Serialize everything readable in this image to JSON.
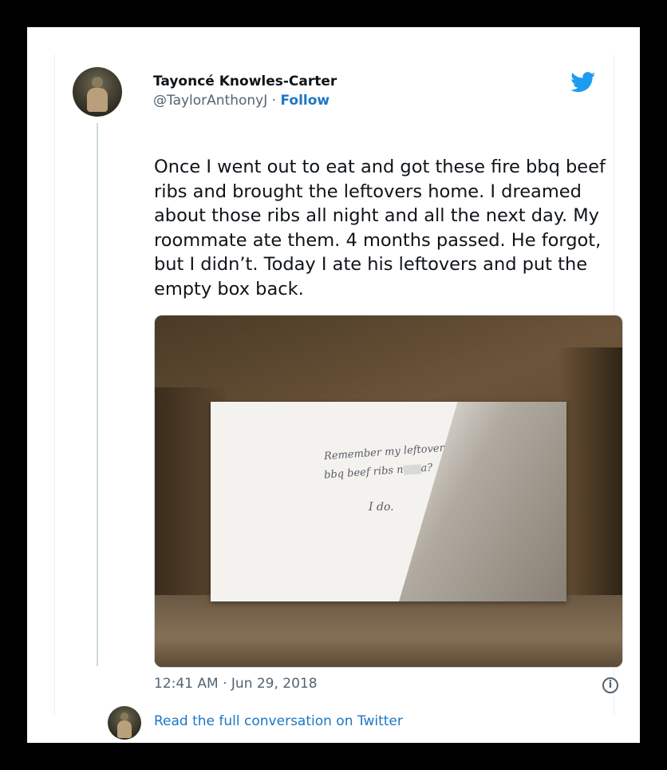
{
  "tweet": {
    "author_name": "Tayoncé Knowles-Carter",
    "author_handle": "@TaylorAnthonyJ",
    "separator": "·",
    "follow_label": "Follow",
    "text": "Once I went out to eat and got these fire bbq beef ribs and brought the leftovers home. I dreamed about those ribs all night and all the next day. My roommate ate them. 4 months passed. He forgot, but I didn’t. Today I ate his leftovers and put the empty box back.",
    "timestamp": "12:41 AM · Jun 29, 2018",
    "read_full_label": "Read the full conversation on Twitter",
    "info_glyph": "i"
  },
  "photo": {
    "note_line1": "Remember my leftover",
    "note_line2a": "bbq beef ribs n",
    "note_line2b": "a?",
    "note_line3": "I do."
  },
  "icons": {
    "logo": "twitter-bird-icon",
    "info": "info-icon"
  },
  "colors": {
    "link_blue": "#1d77c6",
    "twitter_blue": "#1d9bf0",
    "text_dark": "#0f1419",
    "text_gray": "#536471"
  }
}
